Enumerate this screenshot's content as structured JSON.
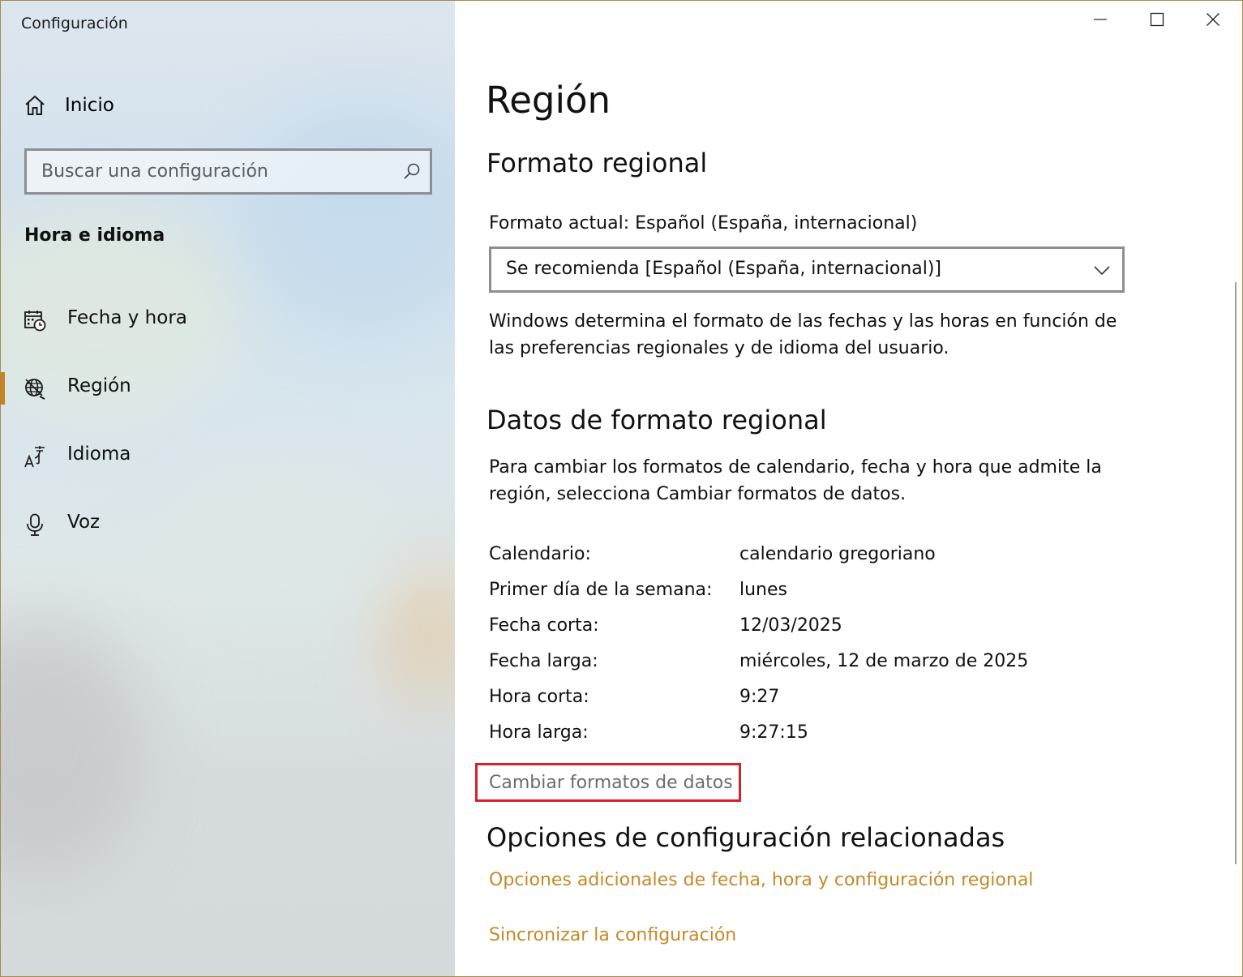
{
  "window": {
    "title": "Configuración",
    "accent_color": "#c7831f",
    "link_color": "#c48a28",
    "highlight_color": "#d7212b"
  },
  "sidebar": {
    "home_label": "Inicio",
    "home_icon": "home-icon",
    "search_placeholder": "Buscar una configuración",
    "section_heading": "Hora e idioma",
    "items": [
      {
        "label": "Fecha y hora",
        "icon": "calendar-clock-icon",
        "selected": false
      },
      {
        "label": "Región",
        "icon": "globe-icon",
        "selected": true
      },
      {
        "label": "Idioma",
        "icon": "language-icon",
        "selected": false
      },
      {
        "label": "Voz",
        "icon": "microphone-icon",
        "selected": false
      }
    ]
  },
  "main": {
    "title": "Región",
    "regional_format": {
      "heading": "Formato regional",
      "current_format": "Formato actual: Español (España, internacional)",
      "dropdown_value": "Se recomienda [Español (España, internacional)]",
      "description_line1": "Windows determina el formato de las fechas y las horas en función de",
      "description_line2": "las preferencias regionales y de idioma del usuario."
    },
    "format_data": {
      "heading": "Datos de formato regional",
      "description_line1": "Para cambiar los formatos de calendario, fecha y hora que admite la",
      "description_line2": "región, selecciona Cambiar formatos de datos.",
      "rows": [
        {
          "label": "Calendario:",
          "value": "calendario gregoriano"
        },
        {
          "label": "Primer día de la semana:",
          "value": "lunes"
        },
        {
          "label": "Fecha corta:",
          "value": "12/03/2025"
        },
        {
          "label": "Fecha larga:",
          "value": "miércoles, 12 de marzo de 2025"
        },
        {
          "label": "Hora corta:",
          "value": "9:27"
        },
        {
          "label": "Hora larga:",
          "value": "9:27:15"
        }
      ],
      "change_link": "Cambiar formatos de datos"
    },
    "related": {
      "heading": "Opciones de configuración relacionadas",
      "links": [
        "Opciones adicionales de fecha, hora y configuración regional",
        "Sincronizar la configuración"
      ]
    }
  }
}
